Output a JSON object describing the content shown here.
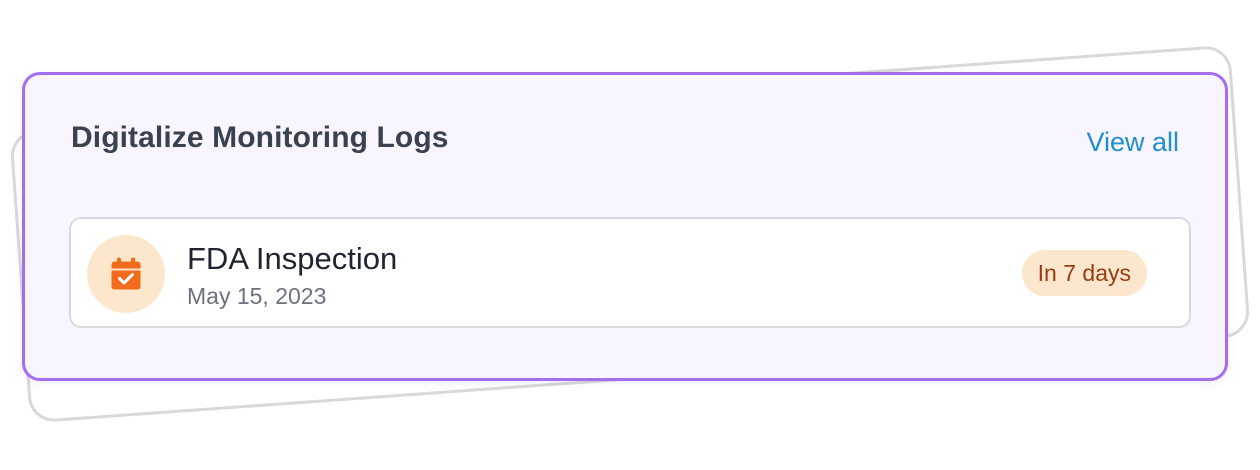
{
  "widget": {
    "title": "Digitalize Monitoring Logs",
    "view_all_label": "View all"
  },
  "event": {
    "icon": "calendar-check-icon",
    "title": "FDA Inspection",
    "date": "May 15, 2023",
    "badge": "In 7 days"
  },
  "colors": {
    "card_border": "#a46ef0",
    "card_background": "#f8f5ff",
    "link": "#1f8fd0",
    "icon_orange": "#f26b1d",
    "icon_bg": "#fde7cc",
    "badge_text": "#9a3c10"
  }
}
